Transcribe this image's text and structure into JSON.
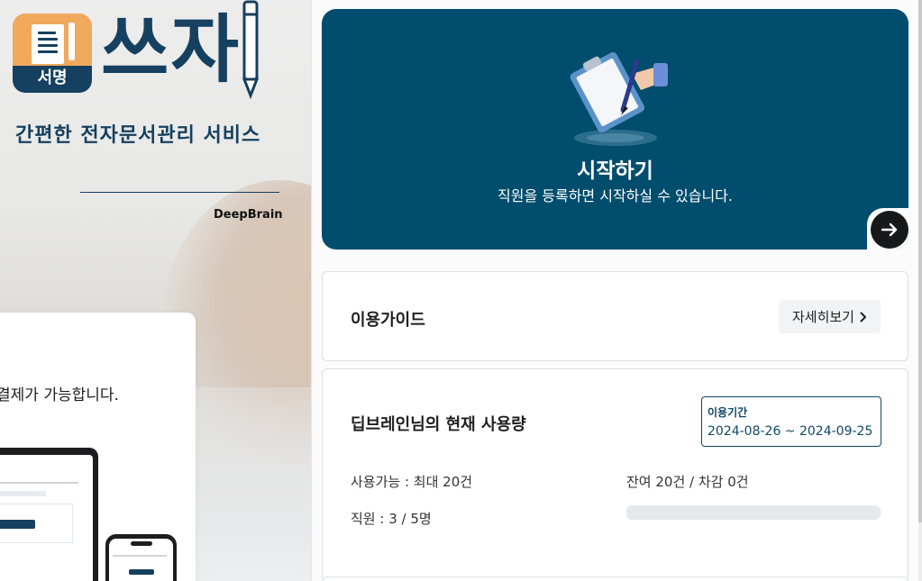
{
  "left_panel": {
    "logo_tile_label": "서명",
    "logo_word": "쓰자",
    "tagline": "간편한 전자문서관리 서비스",
    "brand": "DeepBrain",
    "promo_text": "결제가 가능합니다.",
    "colors": {
      "brand_navy": "#16405f",
      "brand_orange": "#f1a95c"
    }
  },
  "hero": {
    "title": "시작하기",
    "subtitle": "직원을 등록하면 시작하실 수 있습니다.",
    "arrow_icon": "arrow-right-icon",
    "background": "#004d6d"
  },
  "guide": {
    "title": "이용가이드",
    "more_label": "자세히보기"
  },
  "usage": {
    "title": "딥브레인님의 현재 사용량",
    "period_label": "이용기간",
    "period_value": "2024-08-26 ~ 2024-09-25",
    "available": "사용가능 : 최대 20건",
    "employees": "직원 : 3 / 5명",
    "remaining": "잔여 20건 / 차감 0건",
    "used_fraction": 0
  }
}
